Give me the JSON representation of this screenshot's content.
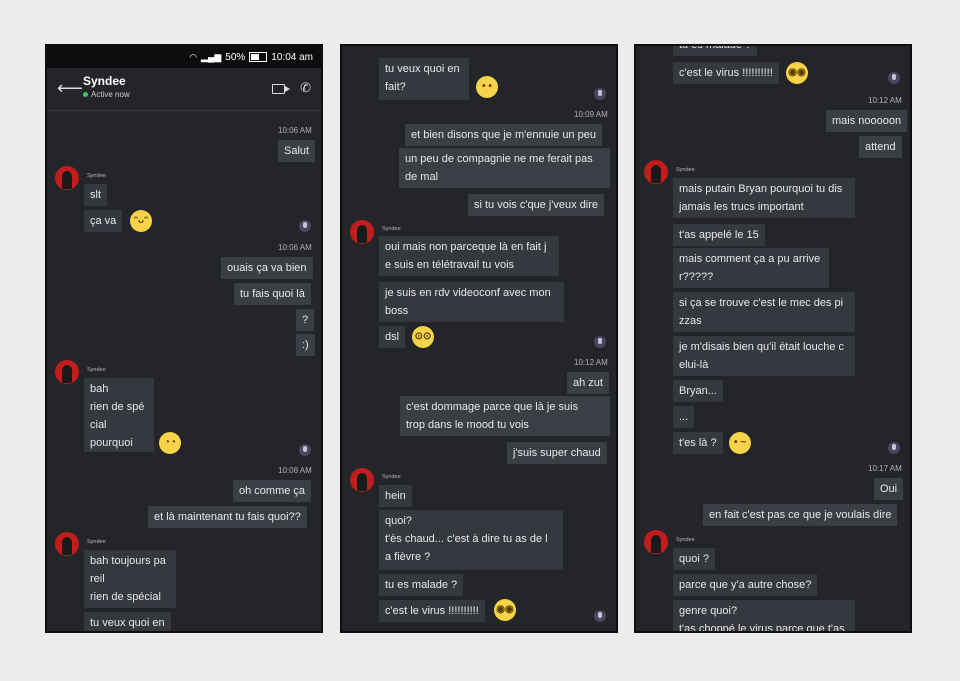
{
  "status_bar": {
    "wifi": "wifi-icon",
    "signal": "signal-icon",
    "battery": "50%",
    "time": "10:04 am"
  },
  "header": {
    "name": "Syndee",
    "status": "Active now"
  },
  "panels": [
    {
      "times": [
        "10:06 AM",
        "10:06 AM",
        "10:08 AM"
      ],
      "senders": [
        "Syndee",
        "Syndee",
        "Syndee"
      ],
      "bubbles": [
        "Salut",
        "slt",
        "ça va",
        "ouais ça va bien",
        "tu fais quoi là",
        "?",
        ":)",
        "bah",
        "rien de spé",
        "cial",
        "pourquoi",
        "oh comme ça",
        "et là maintenant tu fais quoi??",
        "bah toujours pa",
        "reil",
        "rien de spécial",
        "tu veux quoi en"
      ]
    },
    {
      "times": [
        "10:09 AM",
        "10:12 AM"
      ],
      "senders": [
        "Syndee",
        "Syndee"
      ],
      "bubbles": [
        "tu veux quoi en",
        "fait?",
        "et bien disons que je m'ennuie un peu",
        "un peu de compagnie ne me ferait pas",
        "de mal",
        "si tu vois c'que j'veux dire",
        "oui mais non parceque là en fait j",
        "e suis en télétravail tu vois",
        "je suis en rdv videoconf avec mon",
        "boss",
        "dsl",
        "ah zut",
        "c'est dommage parce que là je suis",
        "trop dans le mood tu vois",
        "j'suis super chaud",
        "hein",
        "quoi?",
        "t'ès chaud... c'est à dire tu as de l",
        "a fièvre ?",
        "tu es malade ?",
        "c'est le virus !!!!!!!!!!"
      ]
    },
    {
      "times": [
        "10:12 AM",
        "10:17 AM"
      ],
      "senders": [
        "Syndee",
        "Syndee"
      ],
      "bubbles": [
        "tu es malade ?",
        "c'est le virus !!!!!!!!!!",
        "mais nooooon",
        "attend",
        "mais putain Bryan pourquoi tu dis",
        "jamais les trucs important",
        "t'as appelé le 15",
        "mais comment ça a pu arrive",
        "r?????",
        "si ça se trouve c'est le mec des pi",
        "zzas",
        "je m'disais bien qu'il était louche c",
        "elui-là",
        "Bryan...",
        "...",
        "t'es là ?",
        "Oui",
        "en fait c'est pas ce que je voulais dire",
        "quoi ?",
        "parce que y'a autre chose?",
        "genre quoi?",
        "t'as choppé le virus parce que t'as"
      ]
    }
  ],
  "emojis": [
    "smile-emoji",
    "eye-roll-emoji",
    "neutral-emoji",
    "nerd-emoji",
    "flushed-emoji",
    "flushed-emoji",
    "confused-emoji"
  ]
}
